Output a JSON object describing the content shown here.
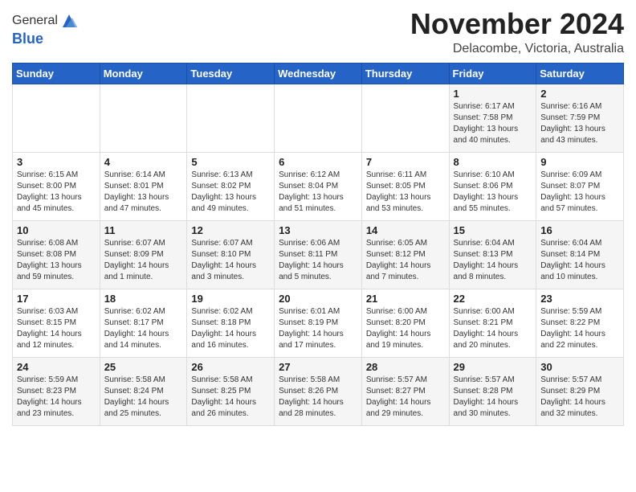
{
  "logo": {
    "general": "General",
    "blue": "Blue"
  },
  "header": {
    "month": "November 2024",
    "location": "Delacombe, Victoria, Australia"
  },
  "weekdays": [
    "Sunday",
    "Monday",
    "Tuesday",
    "Wednesday",
    "Thursday",
    "Friday",
    "Saturday"
  ],
  "weeks": [
    [
      {
        "day": "",
        "info": ""
      },
      {
        "day": "",
        "info": ""
      },
      {
        "day": "",
        "info": ""
      },
      {
        "day": "",
        "info": ""
      },
      {
        "day": "",
        "info": ""
      },
      {
        "day": "1",
        "info": "Sunrise: 6:17 AM\nSunset: 7:58 PM\nDaylight: 13 hours\nand 40 minutes."
      },
      {
        "day": "2",
        "info": "Sunrise: 6:16 AM\nSunset: 7:59 PM\nDaylight: 13 hours\nand 43 minutes."
      }
    ],
    [
      {
        "day": "3",
        "info": "Sunrise: 6:15 AM\nSunset: 8:00 PM\nDaylight: 13 hours\nand 45 minutes."
      },
      {
        "day": "4",
        "info": "Sunrise: 6:14 AM\nSunset: 8:01 PM\nDaylight: 13 hours\nand 47 minutes."
      },
      {
        "day": "5",
        "info": "Sunrise: 6:13 AM\nSunset: 8:02 PM\nDaylight: 13 hours\nand 49 minutes."
      },
      {
        "day": "6",
        "info": "Sunrise: 6:12 AM\nSunset: 8:04 PM\nDaylight: 13 hours\nand 51 minutes."
      },
      {
        "day": "7",
        "info": "Sunrise: 6:11 AM\nSunset: 8:05 PM\nDaylight: 13 hours\nand 53 minutes."
      },
      {
        "day": "8",
        "info": "Sunrise: 6:10 AM\nSunset: 8:06 PM\nDaylight: 13 hours\nand 55 minutes."
      },
      {
        "day": "9",
        "info": "Sunrise: 6:09 AM\nSunset: 8:07 PM\nDaylight: 13 hours\nand 57 minutes."
      }
    ],
    [
      {
        "day": "10",
        "info": "Sunrise: 6:08 AM\nSunset: 8:08 PM\nDaylight: 13 hours\nand 59 minutes."
      },
      {
        "day": "11",
        "info": "Sunrise: 6:07 AM\nSunset: 8:09 PM\nDaylight: 14 hours\nand 1 minute."
      },
      {
        "day": "12",
        "info": "Sunrise: 6:07 AM\nSunset: 8:10 PM\nDaylight: 14 hours\nand 3 minutes."
      },
      {
        "day": "13",
        "info": "Sunrise: 6:06 AM\nSunset: 8:11 PM\nDaylight: 14 hours\nand 5 minutes."
      },
      {
        "day": "14",
        "info": "Sunrise: 6:05 AM\nSunset: 8:12 PM\nDaylight: 14 hours\nand 7 minutes."
      },
      {
        "day": "15",
        "info": "Sunrise: 6:04 AM\nSunset: 8:13 PM\nDaylight: 14 hours\nand 8 minutes."
      },
      {
        "day": "16",
        "info": "Sunrise: 6:04 AM\nSunset: 8:14 PM\nDaylight: 14 hours\nand 10 minutes."
      }
    ],
    [
      {
        "day": "17",
        "info": "Sunrise: 6:03 AM\nSunset: 8:15 PM\nDaylight: 14 hours\nand 12 minutes."
      },
      {
        "day": "18",
        "info": "Sunrise: 6:02 AM\nSunset: 8:17 PM\nDaylight: 14 hours\nand 14 minutes."
      },
      {
        "day": "19",
        "info": "Sunrise: 6:02 AM\nSunset: 8:18 PM\nDaylight: 14 hours\nand 16 minutes."
      },
      {
        "day": "20",
        "info": "Sunrise: 6:01 AM\nSunset: 8:19 PM\nDaylight: 14 hours\nand 17 minutes."
      },
      {
        "day": "21",
        "info": "Sunrise: 6:00 AM\nSunset: 8:20 PM\nDaylight: 14 hours\nand 19 minutes."
      },
      {
        "day": "22",
        "info": "Sunrise: 6:00 AM\nSunset: 8:21 PM\nDaylight: 14 hours\nand 20 minutes."
      },
      {
        "day": "23",
        "info": "Sunrise: 5:59 AM\nSunset: 8:22 PM\nDaylight: 14 hours\nand 22 minutes."
      }
    ],
    [
      {
        "day": "24",
        "info": "Sunrise: 5:59 AM\nSunset: 8:23 PM\nDaylight: 14 hours\nand 23 minutes."
      },
      {
        "day": "25",
        "info": "Sunrise: 5:58 AM\nSunset: 8:24 PM\nDaylight: 14 hours\nand 25 minutes."
      },
      {
        "day": "26",
        "info": "Sunrise: 5:58 AM\nSunset: 8:25 PM\nDaylight: 14 hours\nand 26 minutes."
      },
      {
        "day": "27",
        "info": "Sunrise: 5:58 AM\nSunset: 8:26 PM\nDaylight: 14 hours\nand 28 minutes."
      },
      {
        "day": "28",
        "info": "Sunrise: 5:57 AM\nSunset: 8:27 PM\nDaylight: 14 hours\nand 29 minutes."
      },
      {
        "day": "29",
        "info": "Sunrise: 5:57 AM\nSunset: 8:28 PM\nDaylight: 14 hours\nand 30 minutes."
      },
      {
        "day": "30",
        "info": "Sunrise: 5:57 AM\nSunset: 8:29 PM\nDaylight: 14 hours\nand 32 minutes."
      }
    ]
  ]
}
